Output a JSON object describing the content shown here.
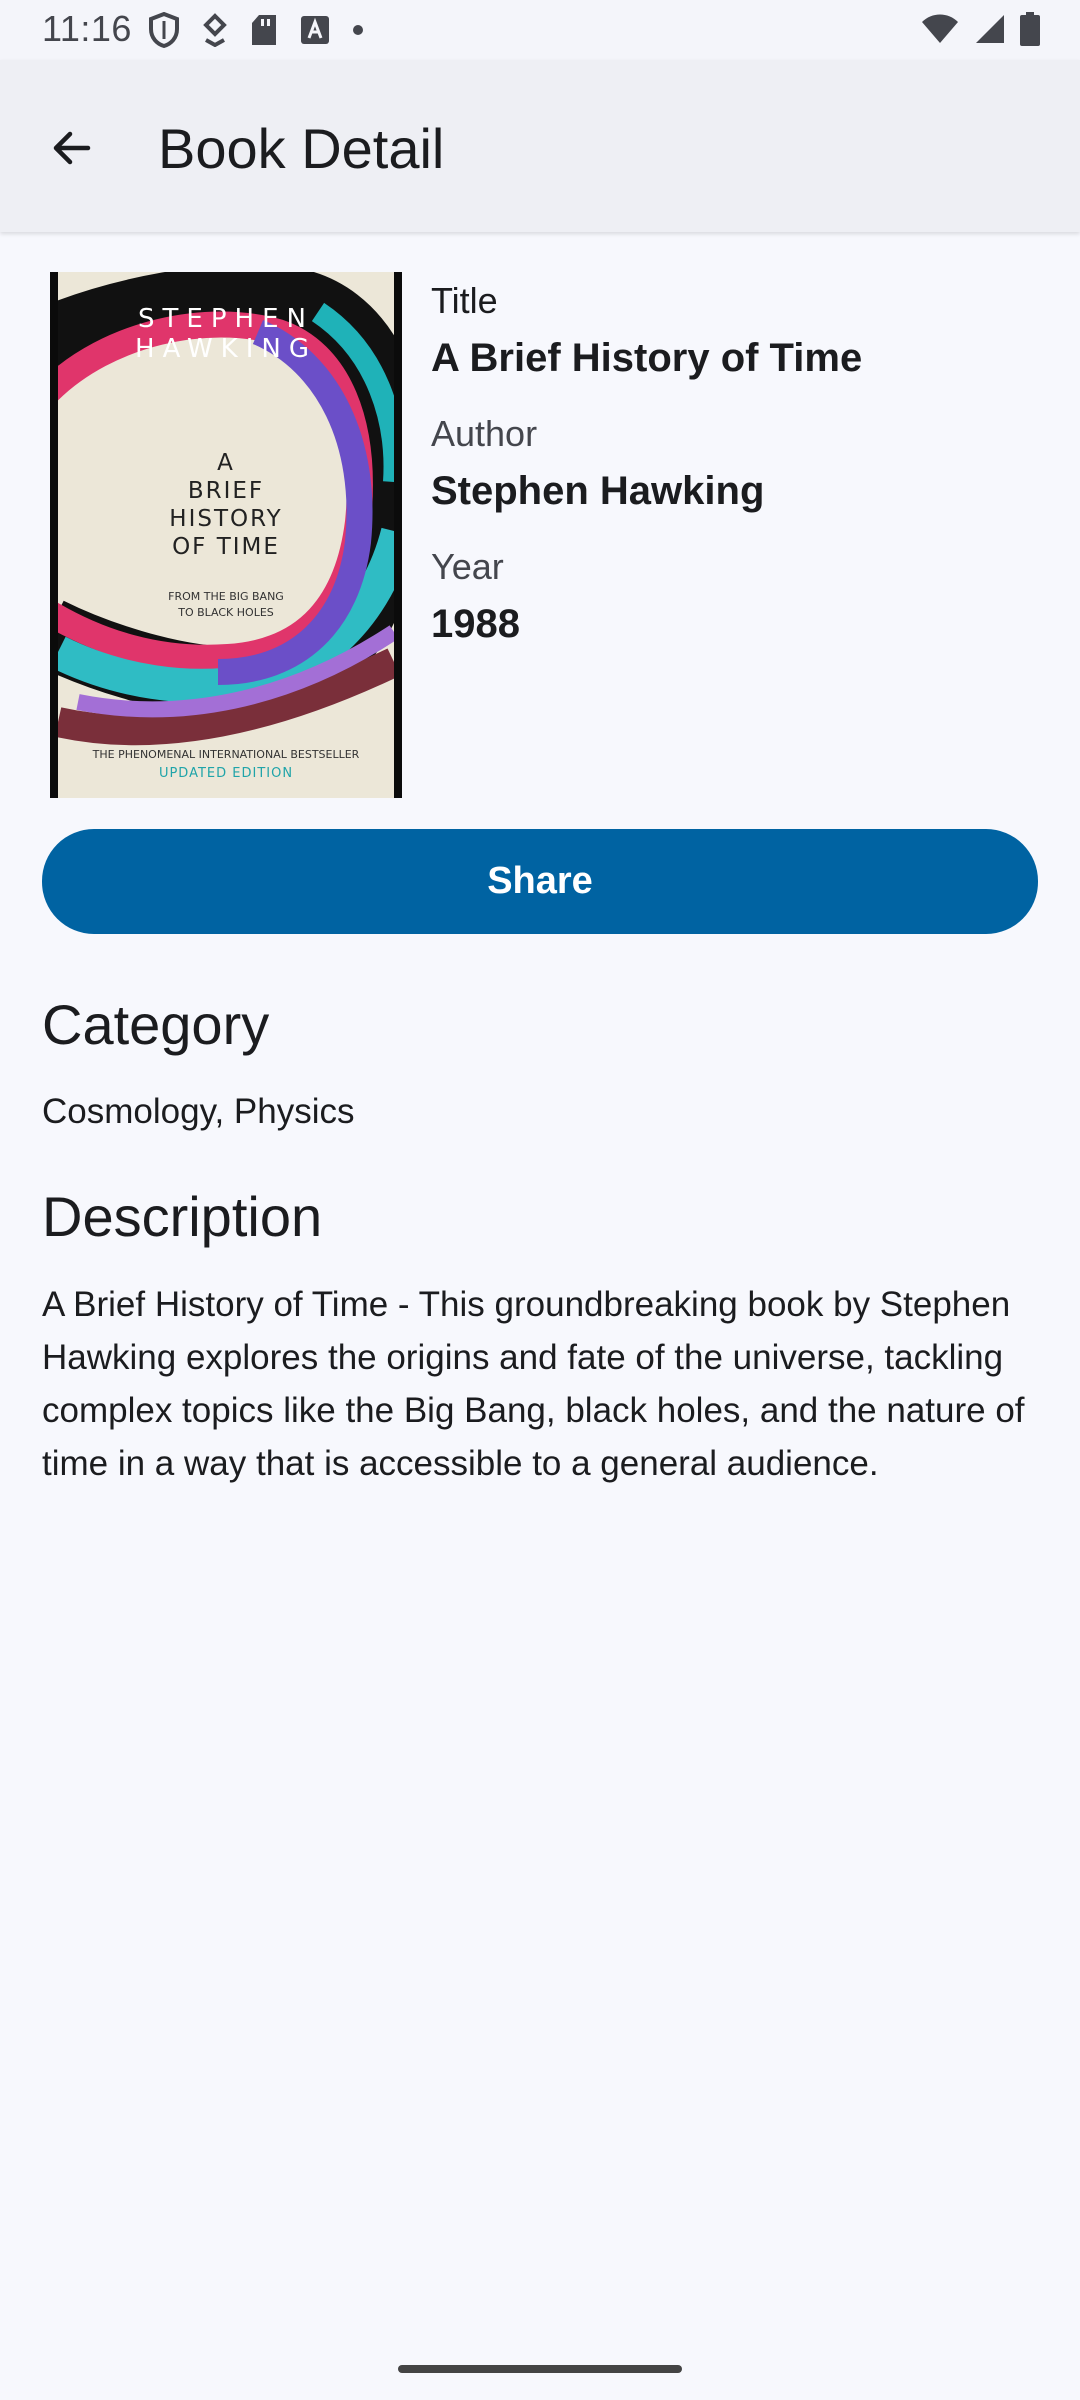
{
  "status_bar": {
    "time": "11:16",
    "icons_left": [
      "shield-icon",
      "download-arrow-icon",
      "sd-card-icon",
      "a-box-icon",
      "dot-icon"
    ],
    "icons_right": [
      "wifi-icon",
      "signal-icon",
      "battery-icon"
    ]
  },
  "app_bar": {
    "back_icon": "arrow-back-icon",
    "title": "Book Detail"
  },
  "book": {
    "cover": {
      "author_line1": "STEPHEN",
      "author_line2": "HAWKING",
      "title_lines": [
        "A",
        "BRIEF",
        "HISTORY",
        "OF TIME"
      ],
      "subtitle_line1": "FROM THE BIG BANG",
      "subtitle_line2": "TO BLACK HOLES",
      "footer": "THE PHENOMENAL INTERNATIONAL BESTSELLER",
      "edition": "UPDATED EDITION"
    },
    "title_label": "Title",
    "title": "A Brief History of Time",
    "author_label": "Author",
    "author": "Stephen Hawking",
    "year_label": "Year",
    "year": "1988"
  },
  "share_button": "Share",
  "category": {
    "heading": "Category",
    "value": "Cosmology, Physics"
  },
  "description": {
    "heading": "Description",
    "text": "A Brief History of Time - This groundbreaking book by Stephen Hawking explores the origins and fate of the universe, tackling complex topics like the Big Bang, black holes, and the nature of time in a way that is accessible to a general audience."
  },
  "colors": {
    "primary": "#0063a2",
    "background": "#f7f8fd",
    "app_bar": "#eeeff4"
  }
}
